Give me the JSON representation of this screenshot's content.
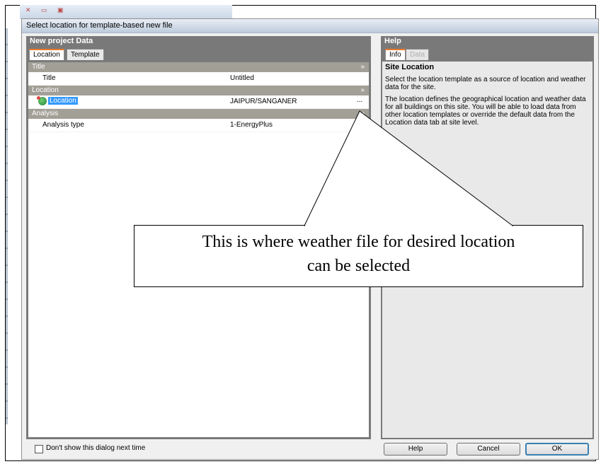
{
  "dialog": {
    "title": "Select location for template-based new file"
  },
  "left_panel": {
    "header": "New project Data",
    "tabs": [
      {
        "label": "Location",
        "active": true
      },
      {
        "label": "Template",
        "active": false
      }
    ],
    "categories": {
      "title": {
        "label": "Title",
        "rows": [
          {
            "name": "Title",
            "value": "Untitled"
          }
        ]
      },
      "location": {
        "label": "Location",
        "rows": [
          {
            "name": "Location",
            "value": "JAIPUR/SANGANER",
            "button": "..."
          }
        ]
      },
      "analysis": {
        "label": "Analysis",
        "rows": [
          {
            "name": "Analysis type",
            "value": "1-EnergyPlus"
          }
        ]
      }
    },
    "collapse_glyph": "»"
  },
  "right_panel": {
    "header": "Help",
    "tabs": [
      {
        "label": "Info",
        "active": true
      },
      {
        "label": "Data",
        "active": false
      }
    ],
    "help_title": "Site Location",
    "paragraphs": [
      "Select the location template as a source of location and weather data for the site.",
      "The location defines the geographical location and weather data for all buildings on this site.  You will be able to load data from other location templates or override the default data from the Location data tab at site level."
    ]
  },
  "footer": {
    "checkbox_label": "Don't show this dialog next time",
    "checkbox_checked": false,
    "buttons": {
      "help": "Help",
      "cancel": "Cancel",
      "ok": "OK"
    }
  },
  "annotation": {
    "line1": "This is where weather file for desired location",
    "line2": "can be selected"
  },
  "colors": {
    "panel_header": "#797979",
    "category_bar": "#a29f97",
    "selection": "#3399ff",
    "active_tab_accent": "#e87a2a"
  }
}
